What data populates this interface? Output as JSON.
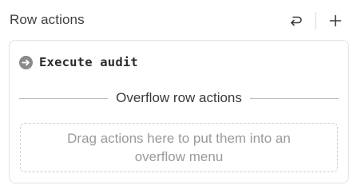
{
  "panel": {
    "title": "Row actions",
    "undo_icon": "undo-icon",
    "add_icon": "plus-icon"
  },
  "actions": [
    {
      "label": "Execute audit",
      "icon": "arrow-circle-right-icon"
    }
  ],
  "overflow": {
    "separator_label": "Overflow row actions",
    "dropzone_text": "Drag actions here to put them into an overflow menu"
  },
  "colors": {
    "text_primary": "#3a3a3a",
    "placeholder": "#9a9a9a",
    "border": "#e2e2e2",
    "icon_fill": "#8a8a8a"
  }
}
